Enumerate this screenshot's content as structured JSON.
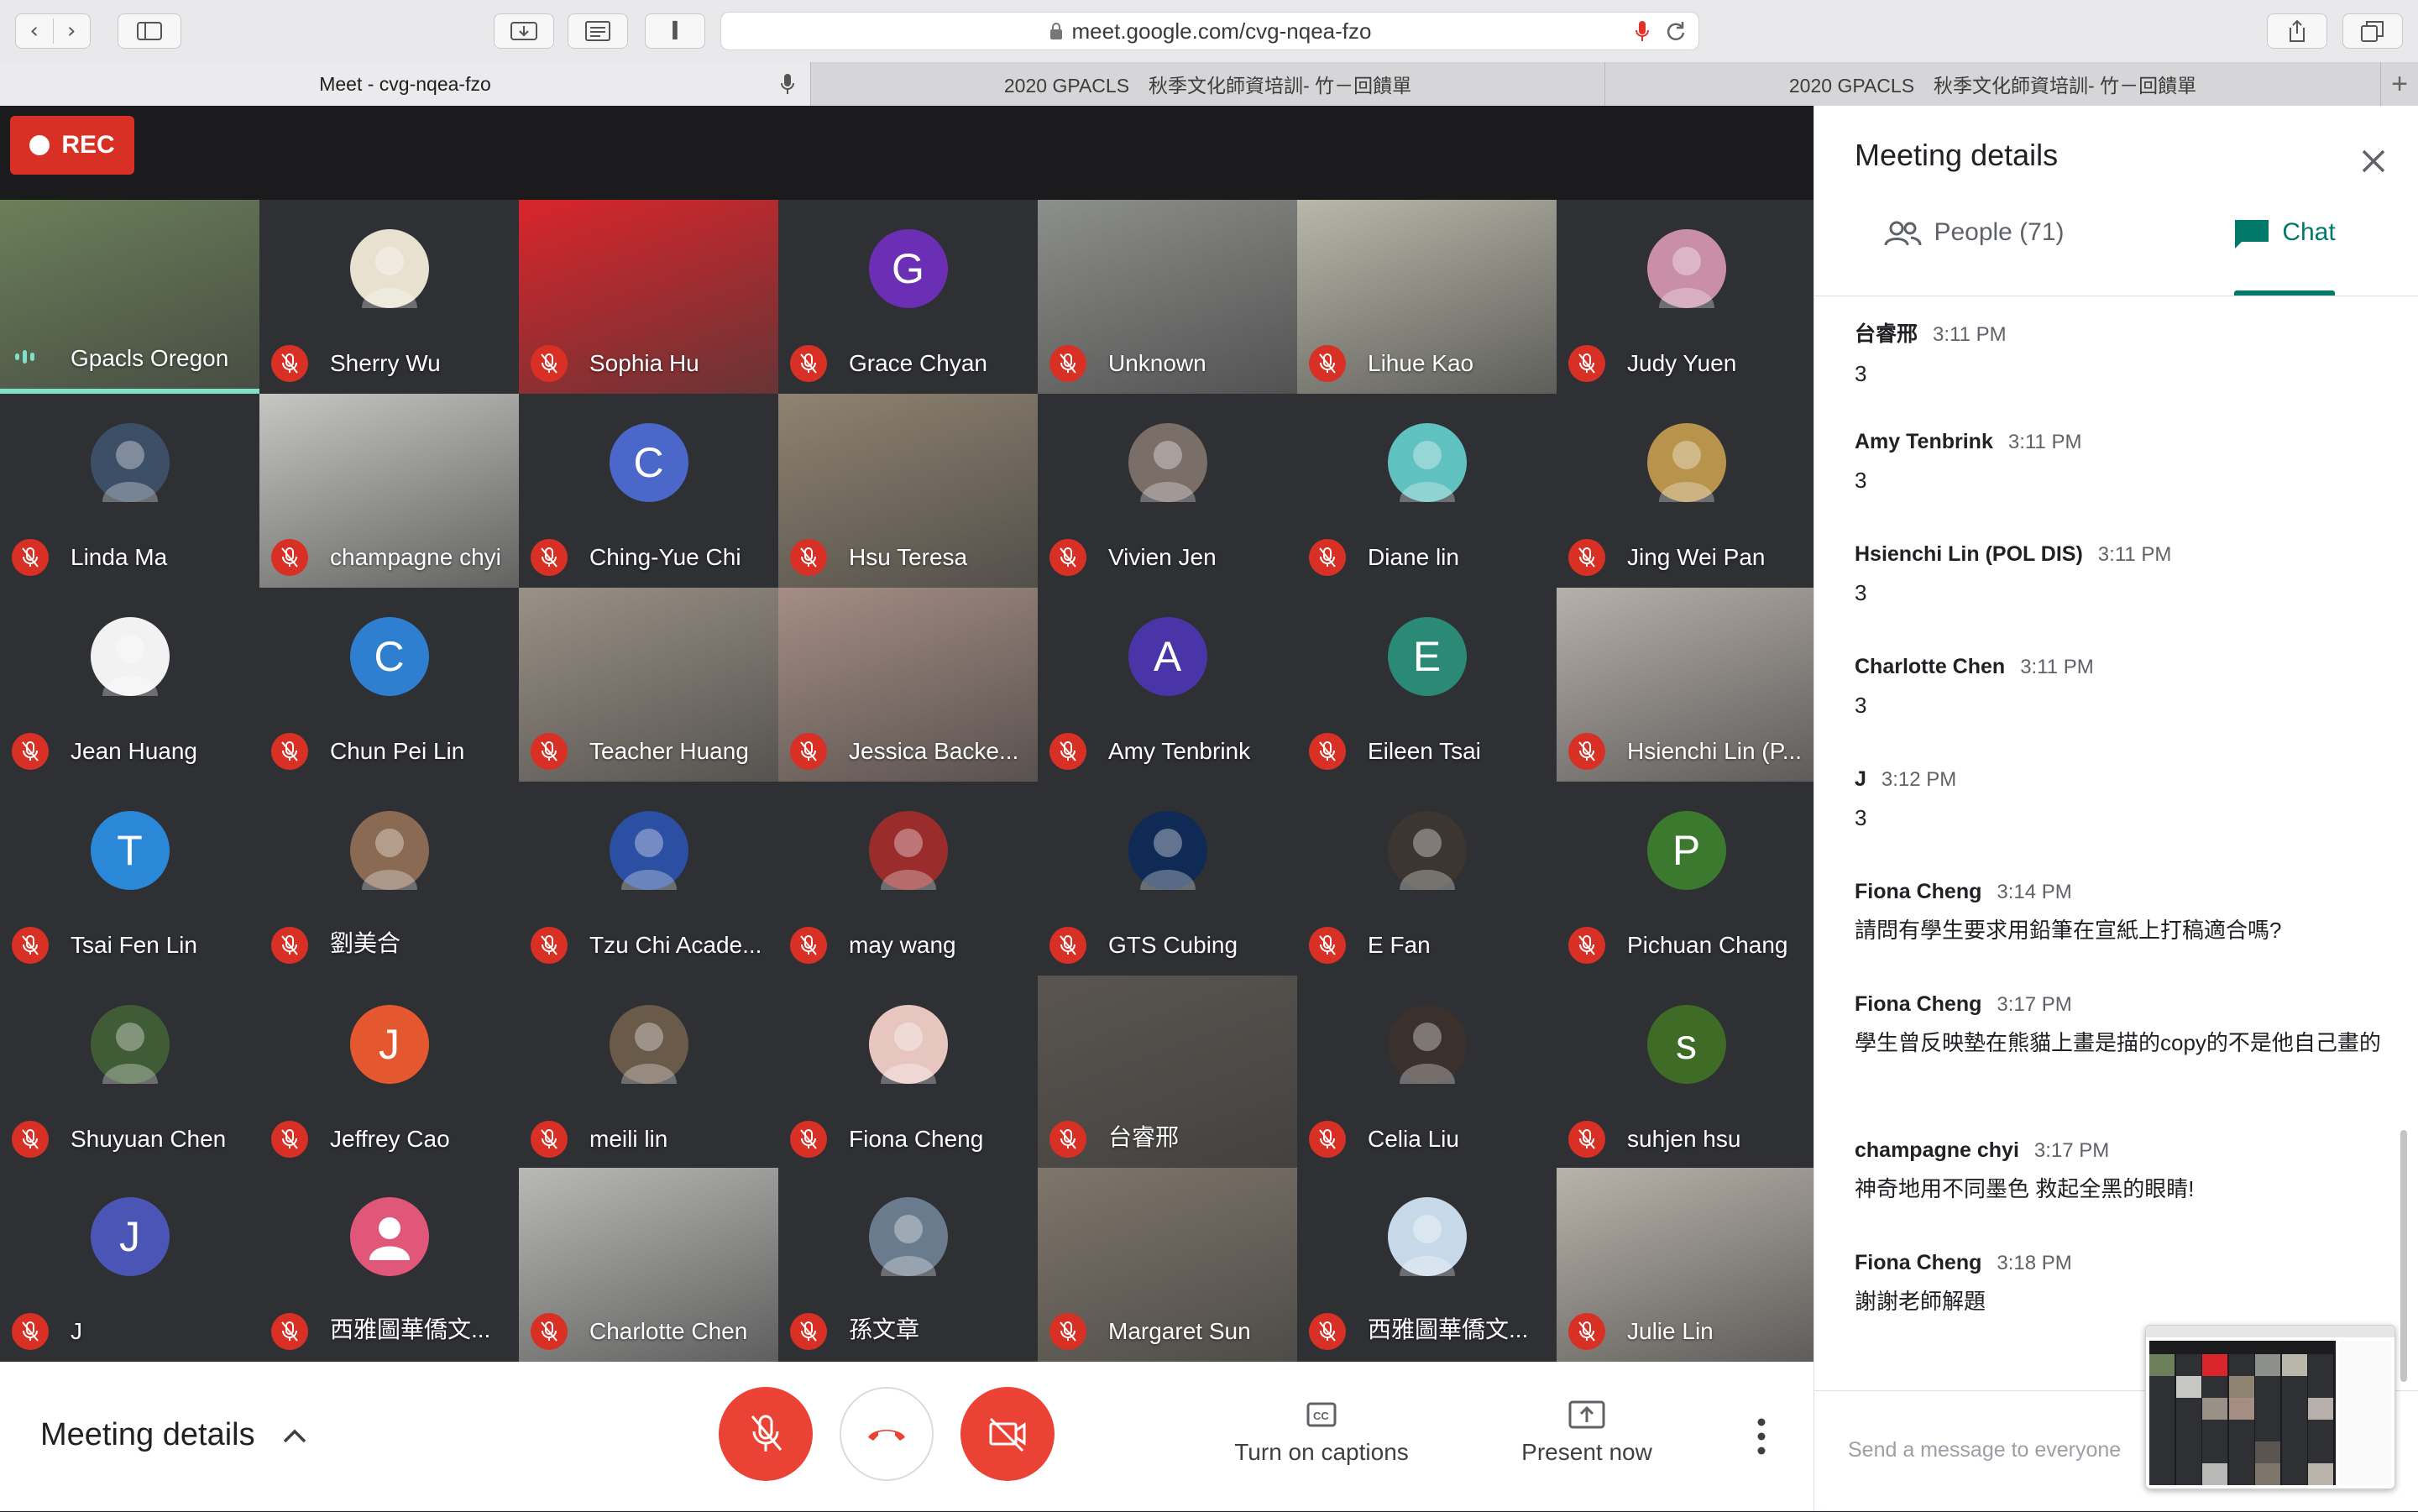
{
  "browser": {
    "url": "meet.google.com/cvg-nqea-fzo",
    "tabs": [
      {
        "label": "Meet - cvg-nqea-fzo",
        "active": true
      },
      {
        "label": "2020 GPACLS　秋季文化師資培訓- 竹－回饋單",
        "active": false
      },
      {
        "label": "2020 GPACLS　秋季文化師資培訓- 竹－回饋單",
        "active": false
      }
    ],
    "new_tab_icon": "plus-icon"
  },
  "meet": {
    "rec_label": "REC",
    "participants": [
      {
        "name": "Gpacls Oregon",
        "type": "video",
        "bg": "#6b7f5a",
        "speaking": true
      },
      {
        "name": "Sherry Wu",
        "type": "avatar",
        "bg": "#e8e1d0",
        "initial": ""
      },
      {
        "name": "Sophia Hu",
        "type": "video",
        "bg": "#d9252b"
      },
      {
        "name": "Grace Chyan",
        "type": "letter",
        "bg": "#6b2fb5",
        "initial": "G"
      },
      {
        "name": "Unknown",
        "type": "video",
        "bg": "#8d8f8c"
      },
      {
        "name": "Lihue Kao",
        "type": "video",
        "bg": "#b8b7a9"
      },
      {
        "name": "Judy Yuen",
        "type": "avatar",
        "bg": "#c98fa8",
        "initial": ""
      },
      {
        "name": "Linda Ma",
        "type": "avatar",
        "bg": "#3d4f66",
        "initial": ""
      },
      {
        "name": "champagne chyi",
        "type": "video",
        "bg": "#c6c6c3"
      },
      {
        "name": "Ching-Yue Chi",
        "type": "letter",
        "bg": "#4a67c9",
        "initial": "C"
      },
      {
        "name": "Hsu Teresa",
        "type": "video",
        "bg": "#8f8371"
      },
      {
        "name": "Vivien Jen",
        "type": "avatar",
        "bg": "#7a6e69",
        "initial": ""
      },
      {
        "name": "Diane lin",
        "type": "avatar",
        "bg": "#5fc1c0",
        "initial": ""
      },
      {
        "name": "Jing Wei Pan",
        "type": "avatar",
        "bg": "#b8934b",
        "initial": ""
      },
      {
        "name": "Jean Huang",
        "type": "avatar",
        "bg": "#f2f2f2",
        "initial": ""
      },
      {
        "name": "Chun Pei Lin",
        "type": "letter",
        "bg": "#2f7fd1",
        "initial": "C"
      },
      {
        "name": "Teacher Huang",
        "type": "video",
        "bg": "#9a9186"
      },
      {
        "name": "Jessica Backe...",
        "type": "video",
        "bg": "#a58d84"
      },
      {
        "name": "Amy Tenbrink",
        "type": "letter",
        "bg": "#4a35a8",
        "initial": "A"
      },
      {
        "name": "Eileen Tsai",
        "type": "letter",
        "bg": "#2a8a76",
        "initial": "E"
      },
      {
        "name": "Hsienchi Lin (P...",
        "type": "video",
        "bg": "#b7b0aa"
      },
      {
        "name": "Tsai Fen Lin",
        "type": "letter",
        "bg": "#2b87d7",
        "initial": "T"
      },
      {
        "name": "劉美合",
        "type": "avatar",
        "bg": "#8a6a52",
        "initial": ""
      },
      {
        "name": "Tzu Chi Acade...",
        "type": "avatar",
        "bg": "#2a4fa3",
        "initial": ""
      },
      {
        "name": "may wang",
        "type": "avatar",
        "bg": "#9a2c2c",
        "initial": ""
      },
      {
        "name": "GTS Cubing",
        "type": "avatar",
        "bg": "#0f2a55",
        "initial": ""
      },
      {
        "name": "E Fan",
        "type": "avatar",
        "bg": "#3c3530",
        "initial": ""
      },
      {
        "name": "Pichuan Chang",
        "type": "letter",
        "bg": "#3b7a2e",
        "initial": "P"
      },
      {
        "name": "Shuyuan Chen",
        "type": "avatar",
        "bg": "#3f5c36",
        "initial": ""
      },
      {
        "name": "Jeffrey Cao",
        "type": "letter",
        "bg": "#e5572f",
        "initial": "J"
      },
      {
        "name": "meili lin",
        "type": "avatar",
        "bg": "#6a5a4a",
        "initial": ""
      },
      {
        "name": "Fiona Cheng",
        "type": "avatar",
        "bg": "#e8c6c0",
        "initial": ""
      },
      {
        "name": "台睿邢",
        "type": "video",
        "bg": "#5a5550"
      },
      {
        "name": "Celia Liu",
        "type": "avatar",
        "bg": "#3a302c",
        "initial": ""
      },
      {
        "name": "suhjen hsu",
        "type": "letter",
        "bg": "#3e6b26",
        "initial": "s"
      },
      {
        "name": "J",
        "type": "letter",
        "bg": "#4a55b5",
        "initial": "J"
      },
      {
        "name": "西雅圖華僑文...",
        "type": "person",
        "bg": "#e0577a",
        "initial": ""
      },
      {
        "name": "Charlotte Chen",
        "type": "video",
        "bg": "#b9b9b7"
      },
      {
        "name": "孫文章",
        "type": "avatar",
        "bg": "#6a7b8e",
        "initial": ""
      },
      {
        "name": "Margaret Sun",
        "type": "video",
        "bg": "#7f766b"
      },
      {
        "name": "西雅圖華僑文...",
        "type": "avatar",
        "bg": "#c7d9e8",
        "initial": ""
      },
      {
        "name": "Julie Lin",
        "type": "video",
        "bg": "#b9b3aa"
      }
    ]
  },
  "bottom_bar": {
    "meeting_details_label": "Meeting details",
    "captions_label": "Turn on captions",
    "present_label": "Present now"
  },
  "panel": {
    "title": "Meeting details",
    "tabs": {
      "people": "People (71)",
      "chat": "Chat"
    },
    "messages": [
      {
        "sender": "台睿邢",
        "time": "3:11 PM",
        "text": "3"
      },
      {
        "sender": "Amy Tenbrink",
        "time": "3:11 PM",
        "text": "3"
      },
      {
        "sender": "Hsienchi Lin (POL DIS)",
        "time": "3:11 PM",
        "text": "3"
      },
      {
        "sender": "Charlotte Chen",
        "time": "3:11 PM",
        "text": "3"
      },
      {
        "sender": "J",
        "time": "3:12 PM",
        "text": "3"
      },
      {
        "sender": "Fiona Cheng",
        "time": "3:14 PM",
        "text": "請問有學生要求用鉛筆在宣紙上打稿適合嗎?"
      },
      {
        "sender": "Fiona Cheng",
        "time": "3:17 PM",
        "text": "學生曾反映墊在熊貓上畫是描的copy的不是他自己畫的"
      },
      {
        "sender": "champagne chyi",
        "time": "3:17 PM",
        "text": "神奇地用不同墨色 救起全黑的眼睛!"
      },
      {
        "sender": "Fiona Cheng",
        "time": "3:18 PM",
        "text": "謝謝老師解題"
      }
    ],
    "send_placeholder": "Send a message to everyone"
  }
}
